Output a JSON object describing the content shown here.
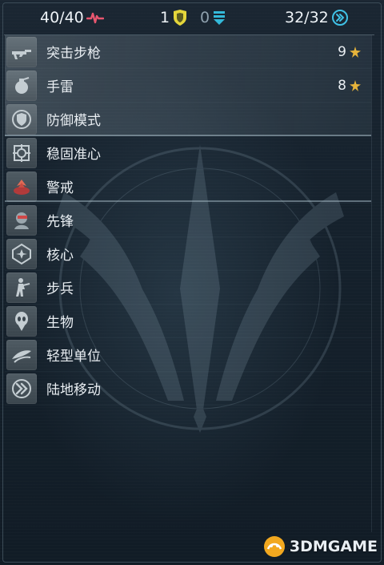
{
  "header": {
    "hp": "40/40",
    "armor": "1",
    "shield": "0",
    "move": "32/32"
  },
  "rows": [
    {
      "label": "突击步枪",
      "cost": "9",
      "icon": "assault-rifle-icon"
    },
    {
      "label": "手雷",
      "cost": "8",
      "icon": "grenade-icon"
    },
    {
      "label": "防御模式",
      "icon": "defense-mode-icon"
    },
    {
      "label": "稳固准心",
      "icon": "steady-aim-icon"
    },
    {
      "label": "警戒",
      "icon": "overwatch-icon"
    },
    {
      "label": "先锋",
      "icon": "vanguard-icon"
    },
    {
      "label": "核心",
      "icon": "core-icon"
    },
    {
      "label": "步兵",
      "icon": "infantry-icon"
    },
    {
      "label": "生物",
      "icon": "biological-icon"
    },
    {
      "label": "轻型单位",
      "icon": "light-unit-icon"
    },
    {
      "label": "陆地移动",
      "icon": "ground-movement-icon"
    }
  ],
  "watermark": {
    "text": "3DMGAME"
  },
  "colors": {
    "hp": "#e8566f",
    "armor": "#e5d63a",
    "shield": "#33b9d9",
    "move": "#3fc1e6",
    "star": "#e7b43a"
  }
}
